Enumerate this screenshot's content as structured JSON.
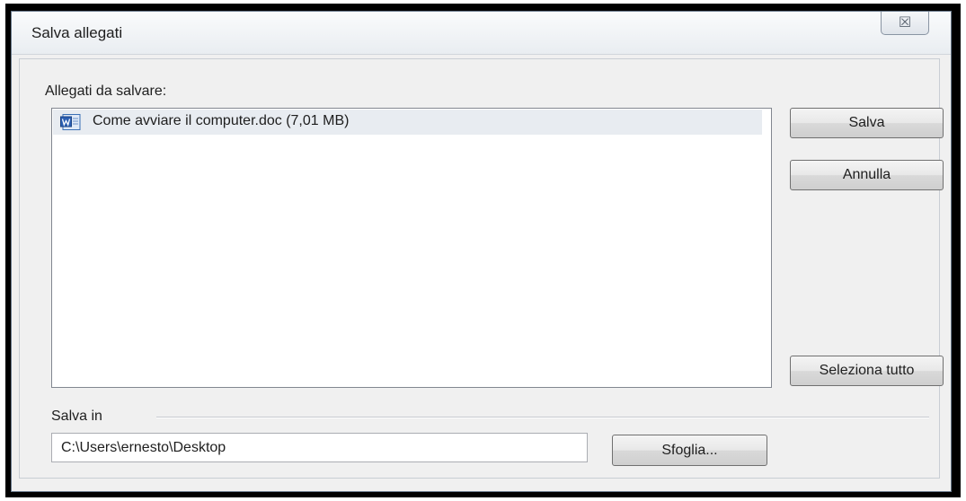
{
  "window": {
    "title": "Salva allegati",
    "close_symbol": "☒",
    "close_icon": "close-icon"
  },
  "attachments": {
    "label": "Allegati da salvare:",
    "items": [
      {
        "label": "Come avviare il computer.doc (7,01 MB)",
        "icon": "word-document-icon",
        "selected": true
      }
    ]
  },
  "buttons": {
    "save": "Salva",
    "cancel": "Annulla",
    "select_all": "Seleziona tutto",
    "browse": "Sfoglia..."
  },
  "save_in": {
    "label": "Salva in",
    "path": "C:\\Users\\ernesto\\Desktop"
  },
  "colors": {
    "selection_background": "#e8ecf1",
    "frame": "#000000",
    "dialog_background": "#f0f0f0"
  }
}
